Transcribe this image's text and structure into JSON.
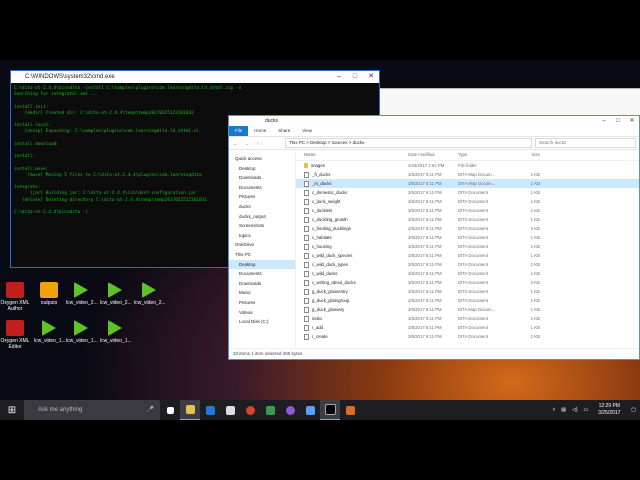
{
  "cmd": {
    "title": "C:\\WINDOWS\\system32\\cmd.exe",
    "lines": [
      "C:\\dita-ot-2.4.4\\bin>dita -install C:\\samples\\plugins\\com.learningdita.ld_xhtml.zip -v",
      "Searching for integrator.xml ...",
      "",
      "install.init:",
      "    [mkdir] Created dir: C:\\dita-ot-2.4.4\\temp\\temp20170325123161032",
      "",
      "install.local:",
      "    [unzip] Expanding: C:\\samples\\plugins\\com.learningdita.ld_xhtml.zi",
      "",
      "install.download:",
      "",
      "install:",
      "",
      "install.move:",
      "     [move] Moving 5 files to C:\\dita-ot-2.4.4\\plugins\\com.learningdita",
      "",
      "integrate:",
      "      [jar] Building jar: C:\\dita-ot-2.4.4\\lib\\dost-configuration.jar",
      "   [delete] Deleting directory C:\\dita-ot-2.4.4\\temp\\temp2017032512261031",
      "",
      "C:\\dita-ot-2.4.4\\bin>dita -l"
    ]
  },
  "explorer": {
    "title": "ducks",
    "tabs": [
      "File",
      "Home",
      "Share",
      "View"
    ],
    "path": "This PC  >  Desktop  >  sources  >  ducks",
    "search_placeholder": "Search ducks",
    "nav_items": [
      {
        "label": "Quick access",
        "type": "sec"
      },
      {
        "label": "Desktop"
      },
      {
        "label": "Downloads"
      },
      {
        "label": "Documents"
      },
      {
        "label": "Pictures"
      },
      {
        "label": "ducks"
      },
      {
        "label": "ducks_output"
      },
      {
        "label": "Screenshots"
      },
      {
        "label": "topics"
      },
      {
        "label": "OneDrive",
        "type": "sec"
      },
      {
        "label": "This PC",
        "type": "sec"
      },
      {
        "label": "Desktop",
        "selected": true
      },
      {
        "label": "Documents"
      },
      {
        "label": "Downloads"
      },
      {
        "label": "Music"
      },
      {
        "label": "Pictures"
      },
      {
        "label": "Videos"
      },
      {
        "label": "Local Disk (C:)"
      }
    ],
    "columns": {
      "name": "Name",
      "date": "Date modified",
      "type": "Type",
      "size": "Size"
    },
    "rows": [
      {
        "name": "images",
        "date": "2/19/2017 1:51 PM",
        "type": "File folder",
        "size": "",
        "kind": "folder"
      },
      {
        "name": "_ft_ducks",
        "date": "3/5/2017 6:11 PM",
        "type": "DITA Map Docum...",
        "size": "1 KB"
      },
      {
        "name": "_m_ducks",
        "date": "3/5/2017 6:11 PM",
        "type": "DITA Map Docum...",
        "size": "1 KB",
        "selected": true
      },
      {
        "name": "c_domestic_ducks",
        "date": "3/5/2017 6:11 PM",
        "type": "DITA Document",
        "size": "1 KB"
      },
      {
        "name": "c_duck_weight",
        "date": "3/5/2017 6:11 PM",
        "type": "DITA Document",
        "size": "1 KB"
      },
      {
        "name": "c_ducklets",
        "date": "3/5/2017 6:11 PM",
        "type": "DITA Document",
        "size": "1 KB"
      },
      {
        "name": "c_duckling_growth",
        "date": "3/5/2017 6:11 PM",
        "type": "DITA Document",
        "size": "1 KB"
      },
      {
        "name": "c_feeding_ducklings",
        "date": "3/5/2017 6:11 PM",
        "type": "DITA Document",
        "size": "2 KB"
      },
      {
        "name": "c_habitats",
        "date": "3/5/2017 6:11 PM",
        "type": "DITA Document",
        "size": "1 KB"
      },
      {
        "name": "c_housing",
        "date": "3/5/2017 6:11 PM",
        "type": "DITA Document",
        "size": "1 KB"
      },
      {
        "name": "c_wild_duck_species",
        "date": "3/5/2017 6:11 PM",
        "type": "DITA Document",
        "size": "1 KB"
      },
      {
        "name": "c_wild_duck_types",
        "date": "3/5/2017 6:11 PM",
        "type": "DITA Document",
        "size": "1 KB"
      },
      {
        "name": "c_wild_ducks",
        "date": "3/5/2017 6:11 PM",
        "type": "DITA Document",
        "size": "1 KB"
      },
      {
        "name": "c_writing_about_ducks",
        "date": "3/5/2017 6:11 PM",
        "type": "DITA Document",
        "size": "2 KB"
      },
      {
        "name": "g_duck_glossentry",
        "date": "3/5/2017 6:11 PM",
        "type": "DITA Document",
        "size": "1 KB"
      },
      {
        "name": "g_duck_glossgroup",
        "date": "3/5/2017 6:11 PM",
        "type": "DITA Document",
        "size": "1 KB"
      },
      {
        "name": "g_duck_glossary",
        "date": "3/5/2017 6:11 PM",
        "type": "DITA Map Docum...",
        "size": "1 KB"
      },
      {
        "name": "index",
        "date": "3/5/2017 6:11 PM",
        "type": "DITA Document",
        "size": "1 KB"
      },
      {
        "name": "r_add",
        "date": "3/5/2017 6:11 PM",
        "type": "DITA Document",
        "size": "1 KB"
      },
      {
        "name": "r_create",
        "date": "3/5/2017 6:11 PM",
        "type": "DITA Document",
        "size": "1 KB"
      }
    ],
    "status": "33 items    1 item selected  460 bytes"
  },
  "desktop_icons": [
    {
      "label": "Oxygen XML Author",
      "icon": "pdf-icon"
    },
    {
      "label": "outputs",
      "icon": "zip-icon"
    },
    {
      "label": "lcw_video_2...",
      "icon": "play-icon"
    },
    {
      "label": "lcw_video_2...",
      "icon": "play-icon"
    },
    {
      "label": "lcw_video_2...",
      "icon": "play-icon"
    },
    {
      "label": "Oxygen XML Editor",
      "icon": "pdf-icon"
    },
    {
      "label": "lcw_video_1...",
      "icon": "play-icon"
    },
    {
      "label": "lcw_video_1...",
      "icon": "play-icon"
    },
    {
      "label": "lcw_video_1...",
      "icon": "play-icon"
    }
  ],
  "taskbar": {
    "search_placeholder": "Ask me anything",
    "time": "12:29 PM",
    "date": "3/25/2017"
  },
  "colors": {
    "accent": "#1979ca",
    "cmd_text": "#13c113",
    "selection": "#cce8ff"
  }
}
